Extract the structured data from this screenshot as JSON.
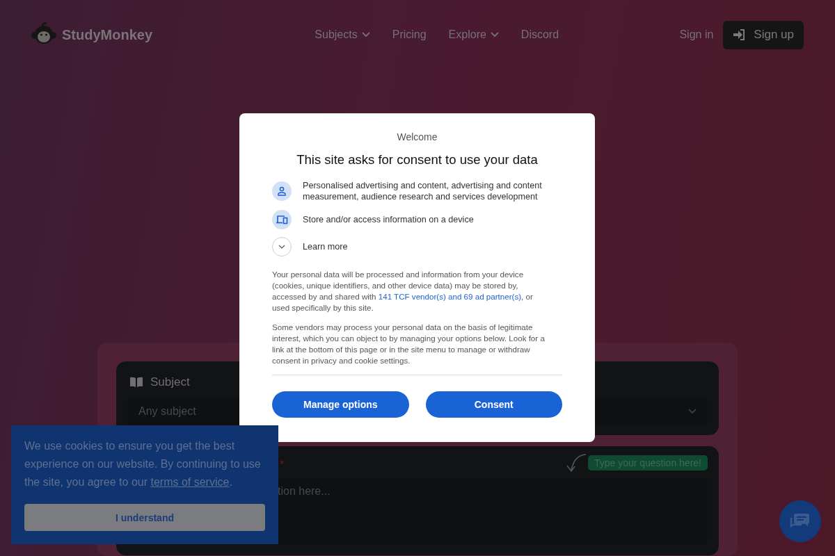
{
  "header": {
    "brand": "StudyMonkey",
    "nav": [
      {
        "label": "Subjects",
        "dropdown": true
      },
      {
        "label": "Pricing",
        "dropdown": false
      },
      {
        "label": "Explore",
        "dropdown": true
      },
      {
        "label": "Discord",
        "dropdown": false
      }
    ],
    "sign_in": "Sign in",
    "sign_up": "Sign up"
  },
  "form": {
    "subject_label": "Subject",
    "subject_placeholder": "Any subject",
    "required_mark": "*",
    "hint": "Type your question here!",
    "question_text_visible": "tion here..."
  },
  "consent_dialog": {
    "eyebrow": "Welcome",
    "title": "This site asks for consent to use your data",
    "purposes": [
      {
        "kind": "person",
        "text": "Personalised advertising and content, advertising and content measurement, audience research and services development"
      },
      {
        "kind": "device",
        "text": "Store and/or access information on a device"
      },
      {
        "kind": "expand",
        "text": "Learn more"
      }
    ],
    "paragraphs": [
      {
        "before": "Your personal data will be processed and information from your device (cookies, unique identifiers, and other device data) may be stored by, accessed by and shared with ",
        "link": "141 TCF vendor(s) and 69 ad partner(s)",
        "after": ", or used specifically by this site."
      },
      {
        "before": "Some vendors may process your personal data on the basis of legitimate interest, which you can object to by managing your options below. Look for a link at the bottom of this page or in the site menu to manage or withdraw consent in privacy and cookie settings."
      }
    ],
    "buttons": [
      "Manage options",
      "Consent"
    ]
  },
  "cookie_banner": {
    "before": "We use cookies to ensure you get the best experience on our website. By continuing to use the site, you agree to our ",
    "link": "terms of service",
    "after": ".",
    "button": "I understand"
  }
}
